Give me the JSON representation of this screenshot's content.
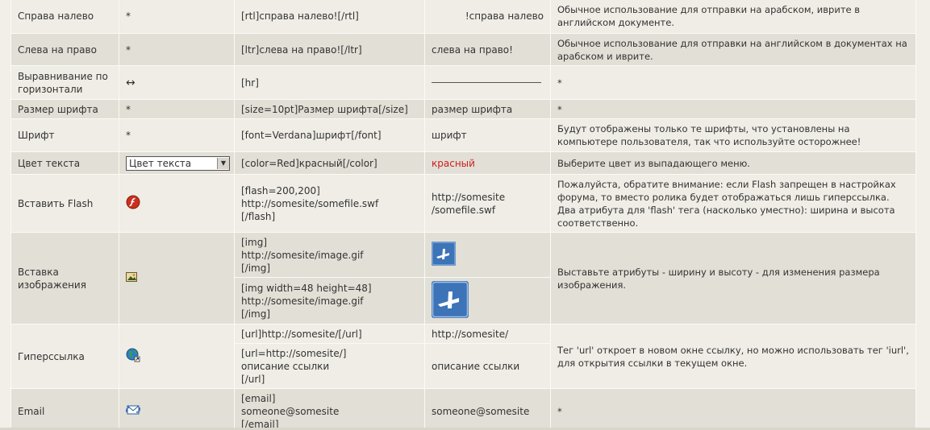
{
  "rows": [
    {
      "name": "Справа налево",
      "icon": "*",
      "code": "[rtl]справа налево![/rtl]",
      "result": "!справа налево",
      "desc": "Обычное использование для отправки на арабском, иврите в английском документе."
    },
    {
      "name": "Слева на право",
      "icon": "*",
      "code": "[ltr]слева на право![/ltr]",
      "result": "слева на право!",
      "desc": "Обычное использование для отправки на английском в документах на арабском и иврите."
    },
    {
      "name": "Выравнивание по горизонтали",
      "icon": "↔",
      "code": "[hr]",
      "desc": "*"
    },
    {
      "name": "Размер шрифта",
      "icon": "*",
      "code": "[size=10pt]Размер шрифта[/size]",
      "result": "размер шрифта",
      "desc": "*"
    },
    {
      "name": "Шрифт",
      "icon": "*",
      "code": "[font=Verdana]шрифт[/font]",
      "result": "шрифт",
      "desc": "Будут отображены только те шрифты, что установлены на компьютере пользователя, так что используйте осторожнее!"
    },
    {
      "name": "Цвет текста",
      "select_value": "Цвет текста",
      "code": "[color=Red]красный[/color]",
      "result": "красный",
      "desc": "Выберите цвет из выпадающего меню."
    },
    {
      "name": "Вставить Flash",
      "code": "[flash=200,200]\nhttp://somesite/somefile.swf\n[/flash]",
      "result": "http://somesite\n/somefile.swf",
      "desc": "Пожалуйста, обратите внимание: если Flash запрещен в настройках форума, то вместо ролика будет отображаться лишь гиперссылка. Два атрибута для 'flash' тега (насколько уместно): ширина и высота соответственно."
    },
    {
      "name": "Вставка изображения",
      "code1": "[img]\nhttp://somesite/image.gif\n[/img]",
      "code2": "[img width=48 height=48]\nhttp://somesite/image.gif\n[/img]",
      "desc": "Выставьте атрибуты - ширину и высоту - для изменения размера изображения."
    },
    {
      "name": "Гиперссылка",
      "code1": "[url]http://somesite/[/url]",
      "result1": "http://somesite/",
      "code2": "[url=http://somesite/]\nописание ссылки\n[/url]",
      "result2": "описание ссылки",
      "desc": "Тег 'url' откроет в новом окне ссылку, но можно использовать тег 'iurl', для открытия ссылки в текущем окне."
    },
    {
      "name": "Email",
      "code": "[email]\nsomeone@somesite\n[/email]",
      "result": "someone@somesite",
      "desc": "*"
    }
  ],
  "colors": {
    "accent_red": "#cc1f1f",
    "row_light": "#efede6",
    "row_dark": "#e2dfd6"
  }
}
